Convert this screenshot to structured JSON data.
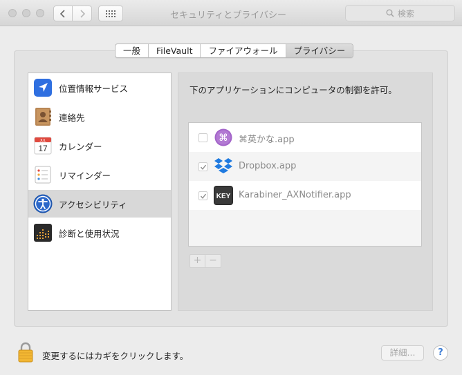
{
  "window": {
    "title": "セキュリティとプライバシー",
    "search_placeholder": "検索"
  },
  "tabs": [
    {
      "label": "一般",
      "active": false
    },
    {
      "label": "FileVault",
      "active": false
    },
    {
      "label": "ファイアウォール",
      "active": false
    },
    {
      "label": "プライバシー",
      "active": true
    }
  ],
  "services": [
    {
      "label": "位置情報サービス",
      "icon": "location-arrow-icon",
      "selected": false
    },
    {
      "label": "連絡先",
      "icon": "contacts-book-icon",
      "selected": false
    },
    {
      "label": "カレンダー",
      "icon": "calendar-icon",
      "calendar_month": "JUL",
      "calendar_day": "17",
      "selected": false
    },
    {
      "label": "リマインダー",
      "icon": "reminders-list-icon",
      "selected": false
    },
    {
      "label": "アクセシビリティ",
      "icon": "accessibility-person-icon",
      "selected": true
    },
    {
      "label": "診断と使用状況",
      "icon": "diagnostics-chart-icon",
      "selected": false
    }
  ],
  "panel": {
    "heading": "下のアプリケーションにコンピュータの制御を許可。",
    "apps": [
      {
        "name": "⌘英かな.app",
        "checked": false,
        "icon": "command-key-icon",
        "icon_glyph": "⌘"
      },
      {
        "name": "Dropbox.app",
        "checked": true,
        "icon": "dropbox-icon"
      },
      {
        "name": "Karabiner_AXNotifier.app",
        "checked": true,
        "icon": "karabiner-key-icon",
        "icon_text": "KEY"
      }
    ],
    "add_label": "+",
    "remove_label": "−"
  },
  "footer": {
    "lock_text": "変更するにはカギをクリックします。",
    "details_label": "詳細...",
    "help_label": "?"
  },
  "colors": {
    "accent": "#3a7bd5",
    "selection": "#d8d8d8",
    "dropbox": "#1f7ae0",
    "lock": "#f2b632"
  }
}
